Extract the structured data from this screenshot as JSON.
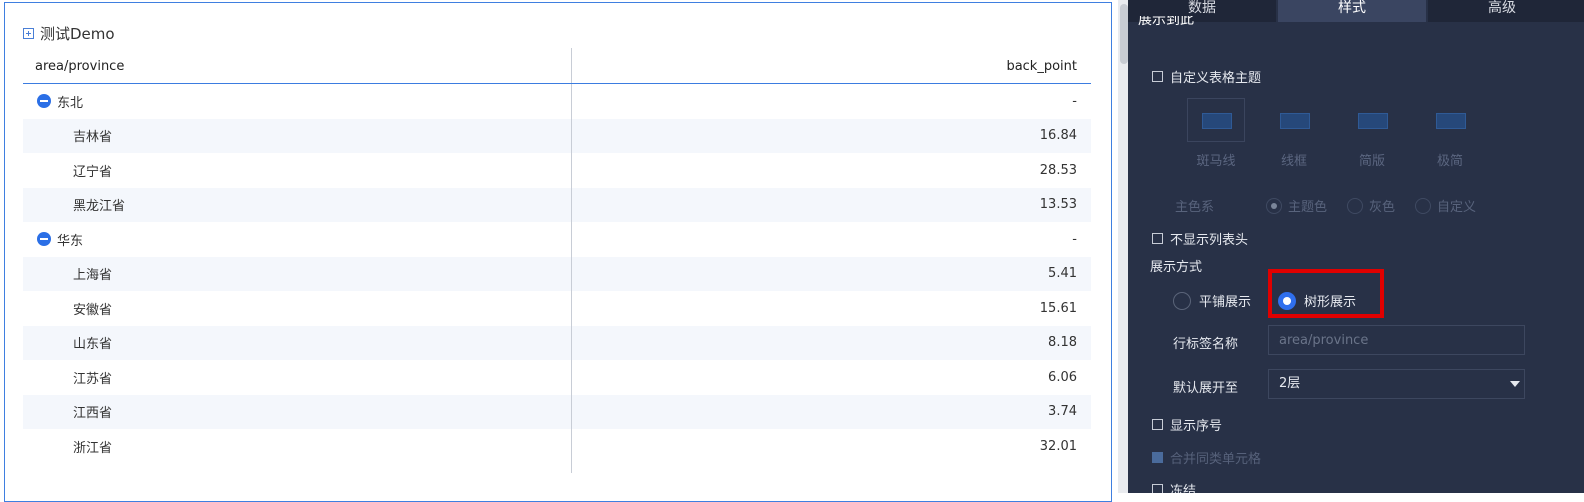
{
  "widget": {
    "title": "测试Demo",
    "columns": [
      "area/province",
      "back_point"
    ],
    "rows": [
      {
        "label": "东北",
        "value": "-"
      },
      {
        "label": "吉林省",
        "value": "16.84"
      },
      {
        "label": "辽宁省",
        "value": "28.53"
      },
      {
        "label": "黑龙江省",
        "value": "13.53"
      },
      {
        "label": "华东",
        "value": "-"
      },
      {
        "label": "上海省",
        "value": "5.41"
      },
      {
        "label": "安徽省",
        "value": "15.61"
      },
      {
        "label": "山东省",
        "value": "8.18"
      },
      {
        "label": "江苏省",
        "value": "6.06"
      },
      {
        "label": "江西省",
        "value": "3.74"
      },
      {
        "label": "浙江省",
        "value": "32.01"
      }
    ]
  },
  "panel": {
    "tabs": [
      "数据",
      "样式",
      "高级"
    ],
    "section_clipped": "展示到此",
    "custom_theme_label": "自定义表格主题",
    "themes": [
      "斑马线",
      "线框",
      "简版",
      "极简"
    ],
    "color_label": "主色系",
    "color_options": [
      "主题色",
      "灰色",
      "自定义"
    ],
    "hide_header_label": "不显示列表头",
    "display_mode_label": "展示方式",
    "display_modes": [
      "平铺展示",
      "树形展示"
    ],
    "row_tag_label": "行标签名称",
    "row_tag_placeholder": "area/province",
    "expand_label": "默认展开至",
    "expand_value": "2层",
    "show_index_label": "显示序号",
    "merge_cells_label": "合并同类单元格",
    "next_clipped": "冻结"
  },
  "colors": {
    "accent": "#2f6fee",
    "highlight": "#e00000",
    "panel_bg": "#283147"
  }
}
